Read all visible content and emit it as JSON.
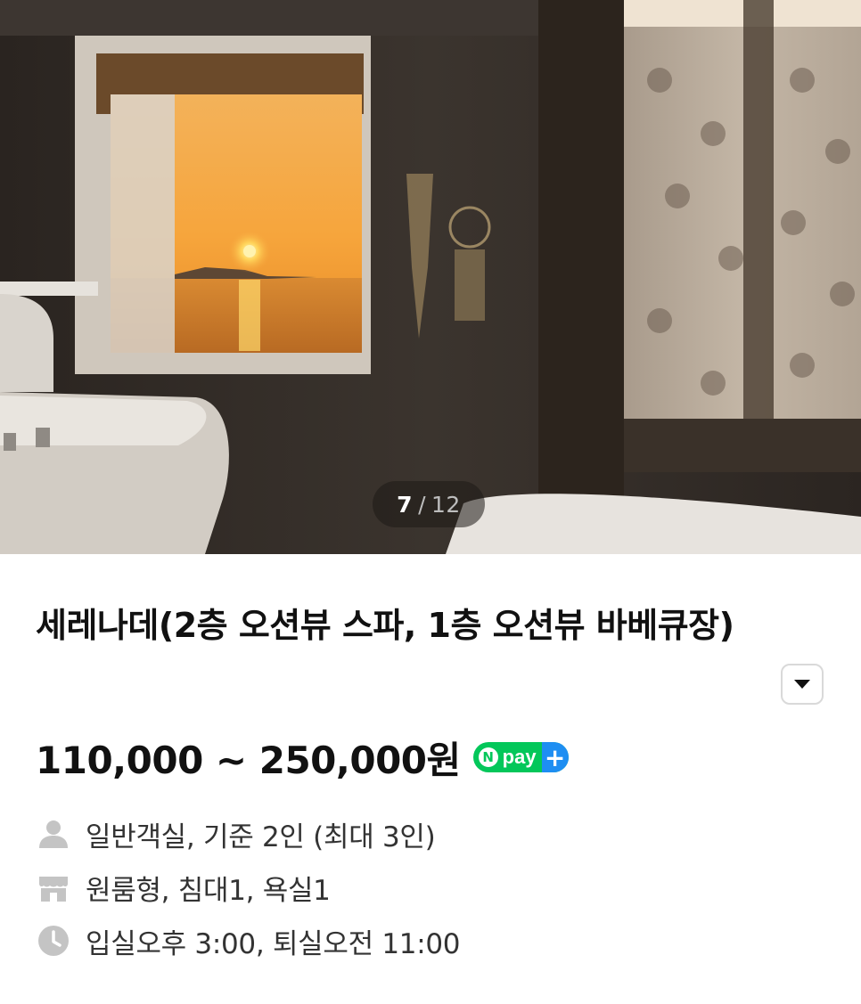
{
  "gallery": {
    "current_index": "7",
    "separator": "/",
    "total": "12"
  },
  "listing": {
    "title": "세레나데(2층 오션뷰 스파, 1층 오션뷰 바베큐장)",
    "price": "110,000 ~ 250,000원",
    "npay_badge": {
      "n_letter": "N",
      "text": "pay",
      "plus": "+"
    },
    "details": [
      {
        "icon": "person-icon",
        "text": "일반객실, 기준 2인 (최대 3인)"
      },
      {
        "icon": "room-icon",
        "text": "원룸형, 침대1, 욕실1"
      },
      {
        "icon": "clock-icon",
        "text": "입실오후 3:00, 퇴실오전 11:00"
      }
    ]
  },
  "colors": {
    "npay_green": "#03c75a",
    "npay_blue": "#1e8ef2",
    "icon_gray": "#c4c4c4"
  }
}
